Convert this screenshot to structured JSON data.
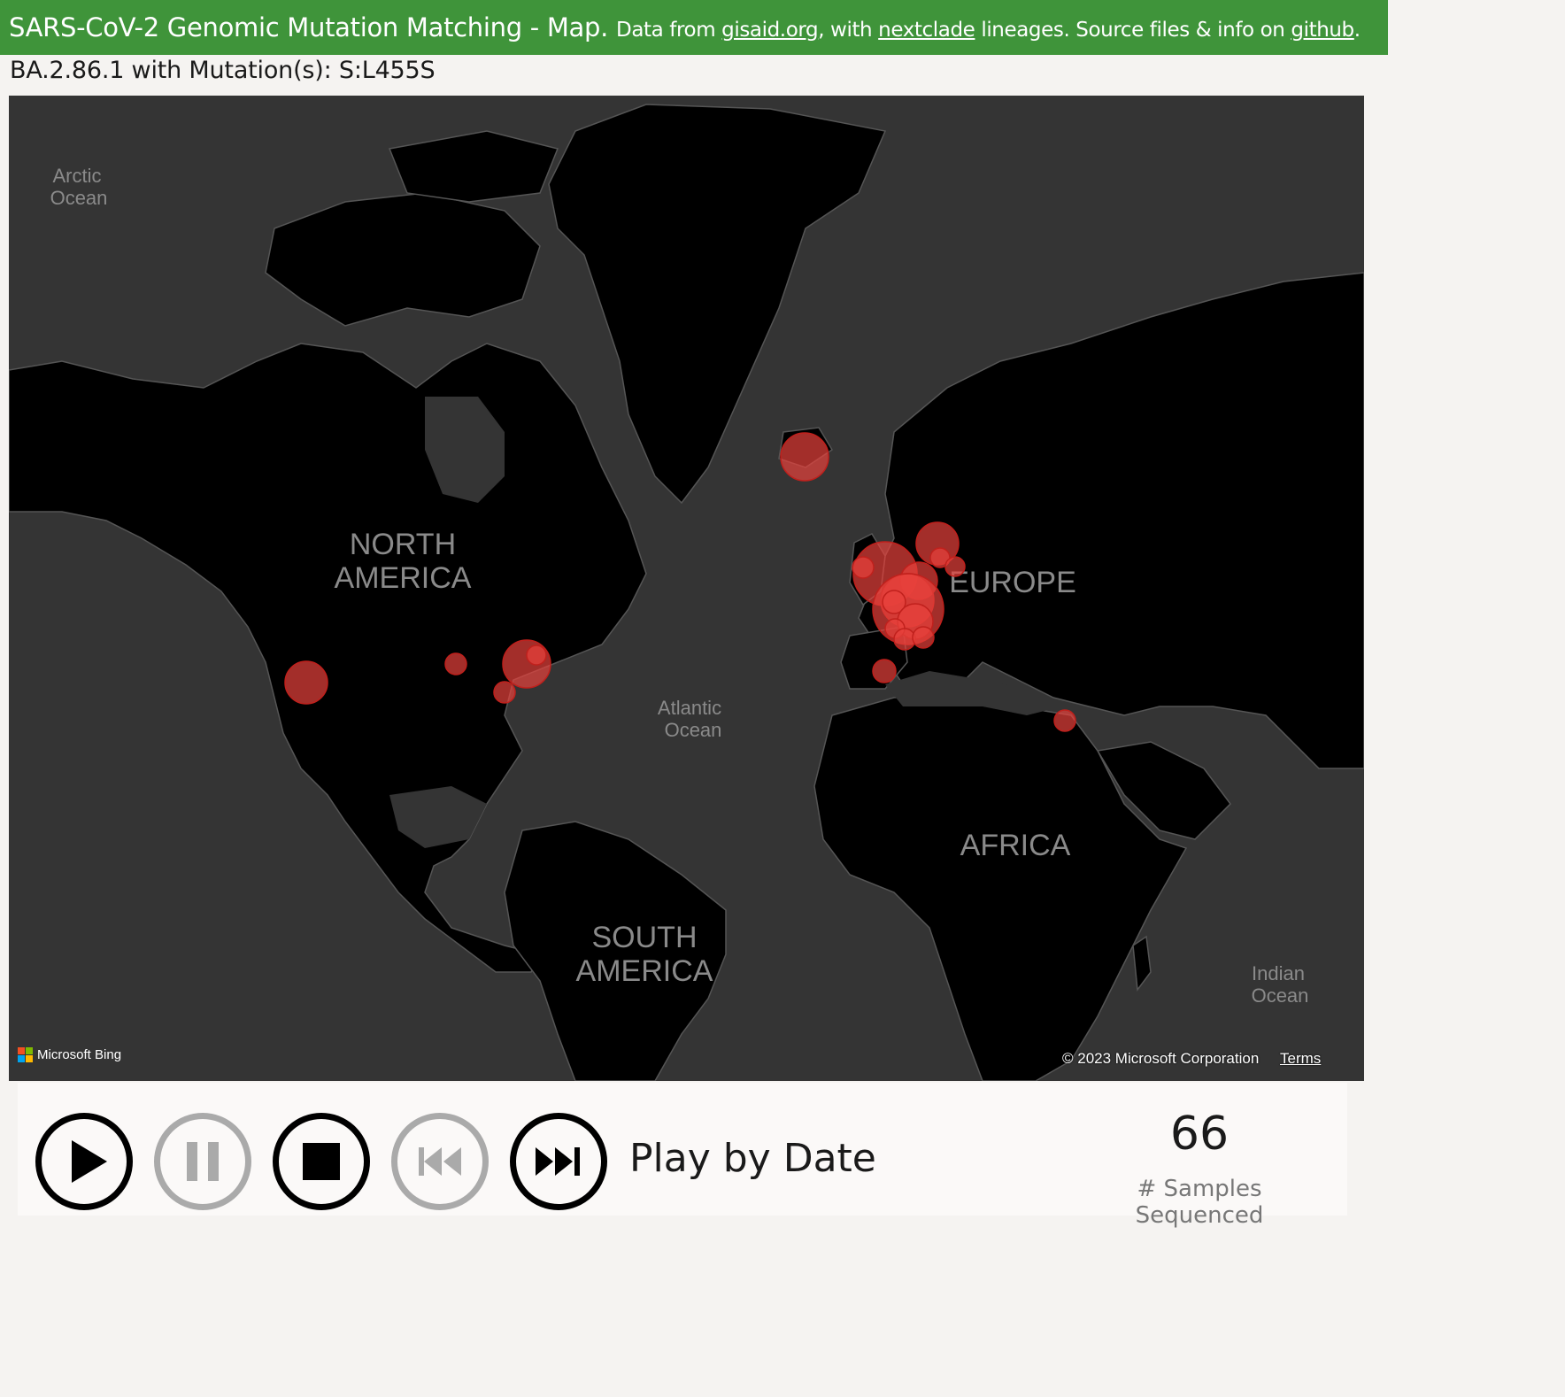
{
  "header": {
    "title": "SARS-CoV-2 Genomic Mutation Matching - Map.",
    "sub_prefix": "Data from",
    "link_gisaid": "gisaid.org",
    "sub_mid": ", with",
    "link_nextclade": "nextclade",
    "sub_mid2": "lineages. Source files & info on",
    "link_github": "github",
    "sub_end": "."
  },
  "subtitle": "BA.2.86.1 with Mutation(s): S:L455S",
  "map": {
    "labels": {
      "north_america_1": "NORTH",
      "north_america_2": "AMERICA",
      "south_america_1": "SOUTH",
      "south_america_2": "AMERICA",
      "europe": "EUROPE",
      "africa": "AFRICA",
      "arctic_1": "Arctic",
      "arctic_2": "Ocean",
      "atlantic_1": "Atlantic",
      "atlantic_2": "Ocean",
      "indian_1": "Indian",
      "indian_2": "Ocean"
    },
    "attribution": "Microsoft Bing",
    "copyright": "© 2023 Microsoft Corporation",
    "terms": "Terms",
    "bubble_color": "#e8413c",
    "land_color": "#000000",
    "water_color": "#343434",
    "border_color": "#5a5a5a"
  },
  "controls": {
    "play_icon": "play-icon",
    "pause_icon": "pause-icon",
    "stop_icon": "stop-icon",
    "rewind_icon": "skip-back-icon",
    "forward_icon": "skip-forward-icon",
    "label": "Play by Date"
  },
  "stats": {
    "count": "66",
    "count_label": "# Samples Sequenced"
  }
}
